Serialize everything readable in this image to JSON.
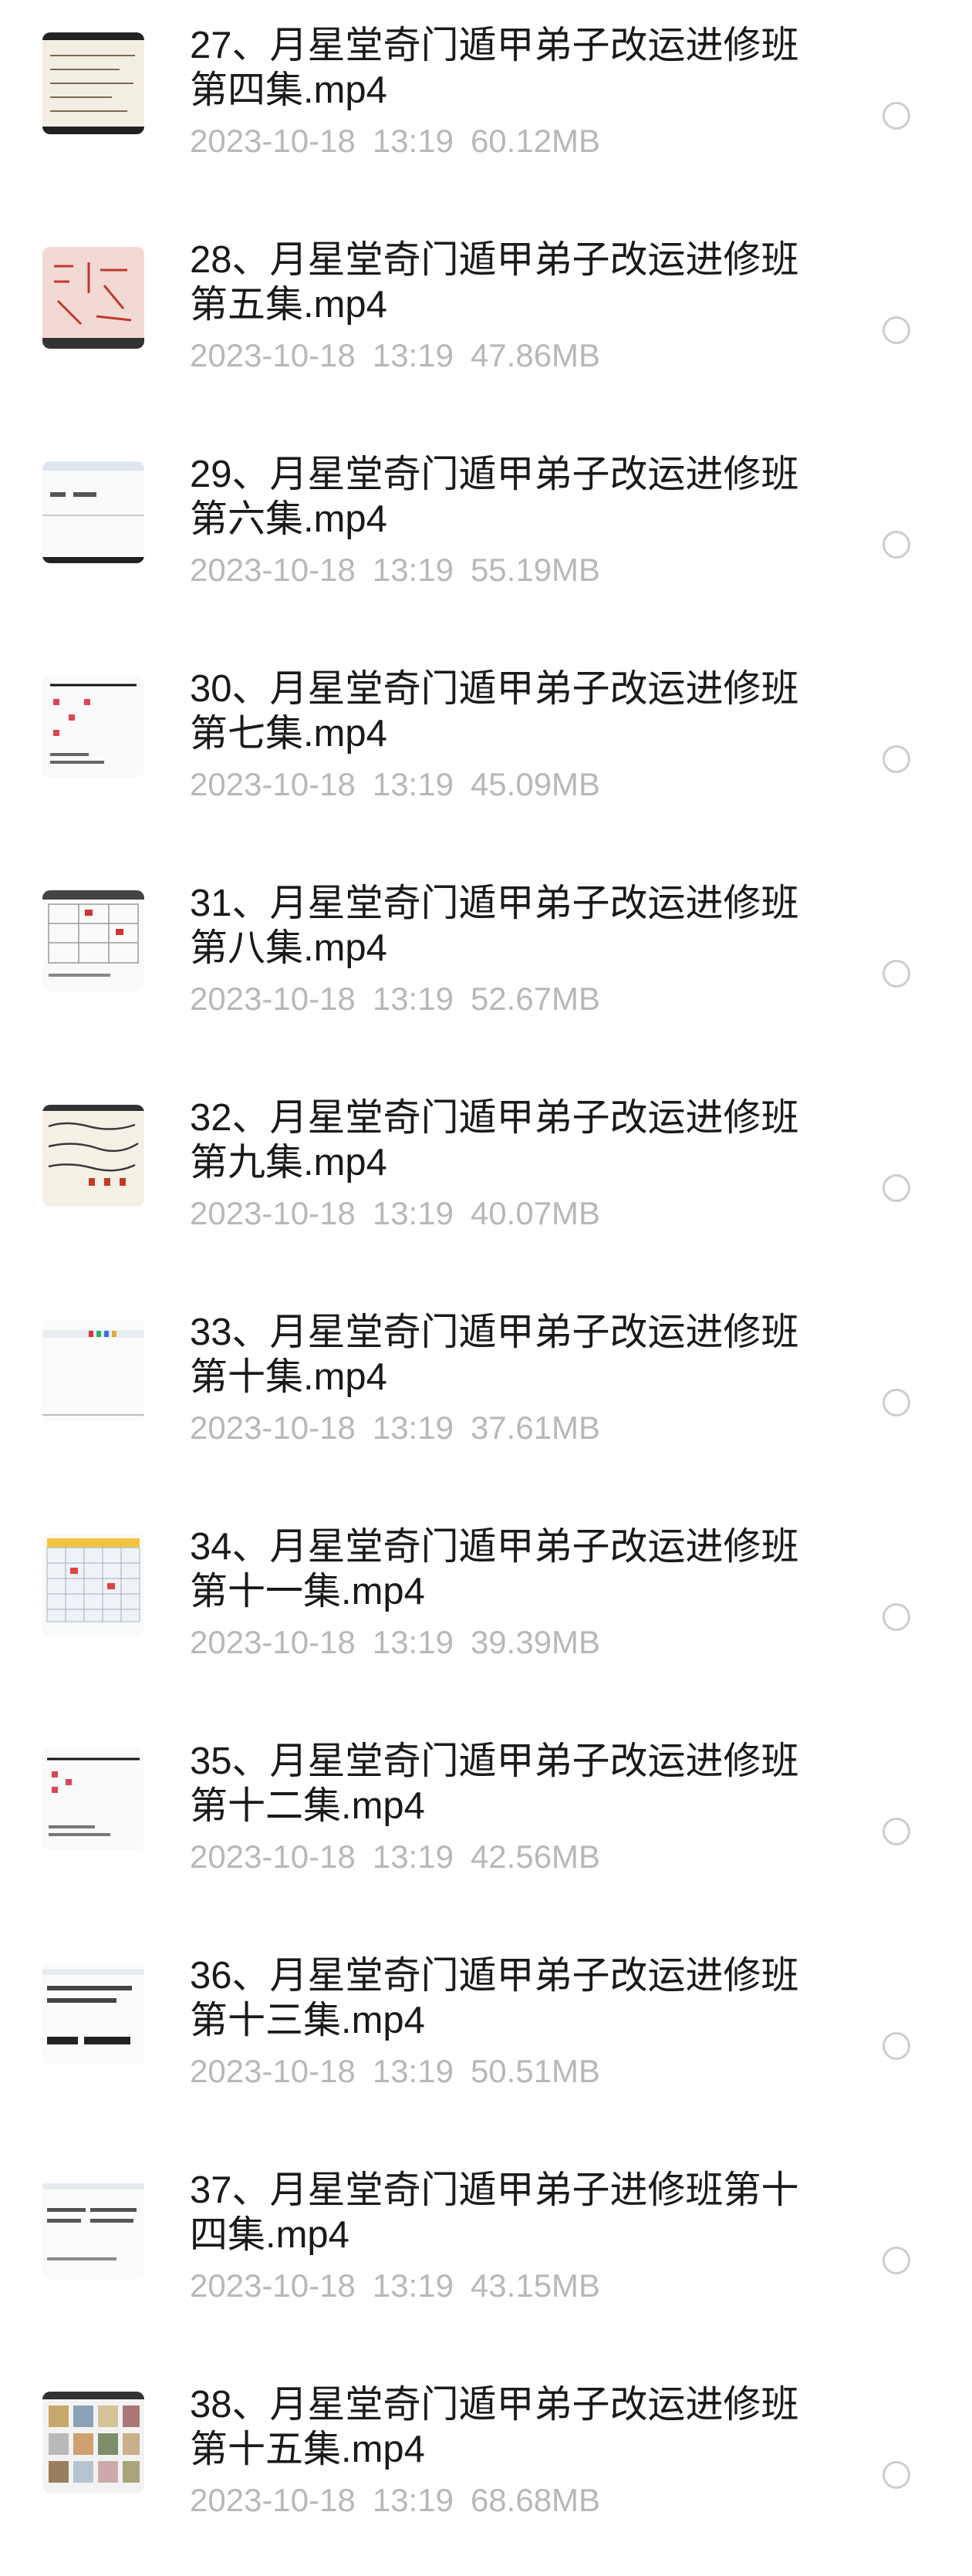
{
  "files": [
    {
      "name": "27、月星堂奇门遁甲弟子改运进修班第四集.mp4",
      "date": "2023-10-18",
      "time": "13:19",
      "size": "60.12MB",
      "thumb": "handwriting-notes-thumbnail"
    },
    {
      "name": "28、月星堂奇门遁甲弟子改运进修班第五集.mp4",
      "date": "2023-10-18",
      "time": "13:19",
      "size": "47.86MB",
      "thumb": "red-ink-paper-thumbnail"
    },
    {
      "name": "29、月星堂奇门遁甲弟子改运进修班第六集.mp4",
      "date": "2023-10-18",
      "time": "13:19",
      "size": "55.19MB",
      "thumb": "document-window-thumbnail"
    },
    {
      "name": "30、月星堂奇门遁甲弟子改运进修班第七集.mp4",
      "date": "2023-10-18",
      "time": "13:19",
      "size": "45.09MB",
      "thumb": "chart-document-thumbnail"
    },
    {
      "name": "31、月星堂奇门遁甲弟子改运进修班第八集.mp4",
      "date": "2023-10-18",
      "time": "13:19",
      "size": "52.67MB",
      "thumb": "grid-table-thumbnail"
    },
    {
      "name": "32、月星堂奇门遁甲弟子改运进修班第九集.mp4",
      "date": "2023-10-18",
      "time": "13:19",
      "size": "40.07MB",
      "thumb": "handwriting-notes-thumbnail"
    },
    {
      "name": "33、月星堂奇门遁甲弟子改运进修班第十集.mp4",
      "date": "2023-10-18",
      "time": "13:19",
      "size": "37.61MB",
      "thumb": "document-window-thumbnail"
    },
    {
      "name": "34、月星堂奇门遁甲弟子改运进修班第十一集.mp4",
      "date": "2023-10-18",
      "time": "13:19",
      "size": "39.39MB",
      "thumb": "spreadsheet-thumbnail"
    },
    {
      "name": "35、月星堂奇门遁甲弟子改运进修班第十二集.mp4",
      "date": "2023-10-18",
      "time": "13:19",
      "size": "42.56MB",
      "thumb": "chart-document-thumbnail"
    },
    {
      "name": "36、月星堂奇门遁甲弟子改运进修班第十三集.mp4",
      "date": "2023-10-18",
      "time": "13:19",
      "size": "50.51MB",
      "thumb": "text-slide-thumbnail"
    },
    {
      "name": "37、月星堂奇门遁甲弟子进修班第十四集.mp4",
      "date": "2023-10-18",
      "time": "13:19",
      "size": "43.15MB",
      "thumb": "text-slide-thumbnail"
    },
    {
      "name": "38、月星堂奇门遁甲弟子改运进修班第十五集.mp4",
      "date": "2023-10-18",
      "time": "13:19",
      "size": "68.68MB",
      "thumb": "image-collage-thumbnail"
    }
  ],
  "colors": {
    "name_text": "#1a1a1a",
    "meta_text": "#b8b8b8",
    "radio_border": "#cdcdcd"
  }
}
